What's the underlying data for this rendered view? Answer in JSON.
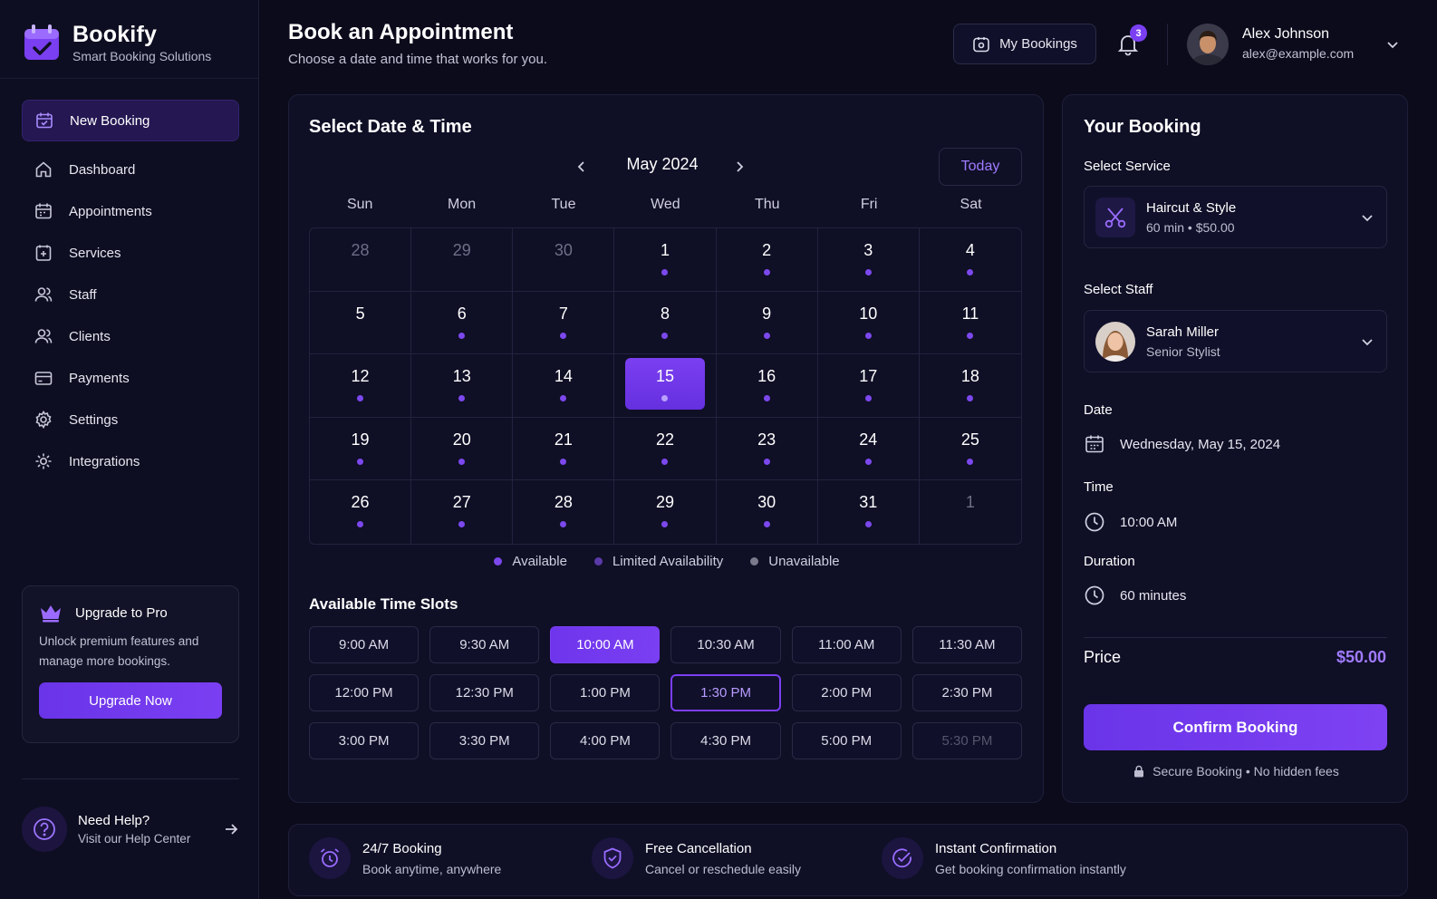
{
  "brand": {
    "name": "Bookify",
    "tagline": "Smart Booking Solutions"
  },
  "sidebar": {
    "items": [
      {
        "label": "New Booking",
        "icon": "calendar-icon",
        "active": true
      },
      {
        "label": "Dashboard",
        "icon": "home-icon"
      },
      {
        "label": "Appointments",
        "icon": "calendar-icon"
      },
      {
        "label": "Services",
        "icon": "services-icon"
      },
      {
        "label": "Staff",
        "icon": "users-icon"
      },
      {
        "label": "Clients",
        "icon": "users-icon"
      },
      {
        "label": "Payments",
        "icon": "credit-card-icon"
      },
      {
        "label": "Settings",
        "icon": "gear-icon"
      },
      {
        "label": "Integrations",
        "icon": "integrations-icon"
      }
    ],
    "upgrade": {
      "title": "Upgrade to Pro",
      "text": "Unlock premium features and manage more bookings.",
      "button": "Upgrade Now"
    },
    "help": {
      "title": "Need Help?",
      "subtitle": "Visit our Help Center"
    }
  },
  "header": {
    "title": "Book an Appointment",
    "subtitle": "Choose a date and time that works for you.",
    "my_bookings": "My Bookings",
    "notification_count": "3",
    "user": {
      "name": "Alex Johnson",
      "email": "alex@example.com"
    }
  },
  "calendar": {
    "title": "Select Date & Time",
    "month": "May 2024",
    "today_label": "Today",
    "weekdays": [
      "Sun",
      "Mon",
      "Tue",
      "Wed",
      "Thu",
      "Fri",
      "Sat"
    ],
    "days": [
      {
        "d": "28",
        "muted": true
      },
      {
        "d": "29",
        "muted": true
      },
      {
        "d": "30",
        "muted": true
      },
      {
        "d": "1",
        "dot": true
      },
      {
        "d": "2",
        "dot": true
      },
      {
        "d": "3",
        "dot": true
      },
      {
        "d": "4",
        "dot": true
      },
      {
        "d": "5"
      },
      {
        "d": "6",
        "dot": true
      },
      {
        "d": "7",
        "dot": true
      },
      {
        "d": "8",
        "dot": true
      },
      {
        "d": "9",
        "dot": true
      },
      {
        "d": "10",
        "dot": true
      },
      {
        "d": "11",
        "dot": true
      },
      {
        "d": "12",
        "dot": true
      },
      {
        "d": "13",
        "dot": true
      },
      {
        "d": "14",
        "dot": true
      },
      {
        "d": "15",
        "dot": true,
        "selected": true
      },
      {
        "d": "16",
        "dot": true
      },
      {
        "d": "17",
        "dot": true
      },
      {
        "d": "18",
        "dot": true
      },
      {
        "d": "19",
        "dot": true
      },
      {
        "d": "20",
        "dot": true
      },
      {
        "d": "21",
        "dot": true
      },
      {
        "d": "22",
        "dot": true
      },
      {
        "d": "23",
        "dot": true
      },
      {
        "d": "24",
        "dot": true
      },
      {
        "d": "25",
        "dot": true
      },
      {
        "d": "26",
        "dot": true
      },
      {
        "d": "27",
        "dot": true
      },
      {
        "d": "28",
        "dot": true
      },
      {
        "d": "29",
        "dot": true
      },
      {
        "d": "30",
        "dot": true
      },
      {
        "d": "31",
        "dot": true
      },
      {
        "d": "1",
        "muted": true
      }
    ],
    "legend": [
      {
        "label": "Available",
        "color": "#7c48ee"
      },
      {
        "label": "Limited Availability",
        "color": "#5a3aa8"
      },
      {
        "label": "Unavailable",
        "color": "#7a7a8c"
      }
    ],
    "slots_title": "Available Time Slots",
    "slots": [
      {
        "t": "9:00 AM"
      },
      {
        "t": "9:30 AM"
      },
      {
        "t": "10:00 AM",
        "state": "sel"
      },
      {
        "t": "10:30 AM"
      },
      {
        "t": "11:00 AM"
      },
      {
        "t": "11:30 AM"
      },
      {
        "t": "12:00 PM"
      },
      {
        "t": "12:30 PM"
      },
      {
        "t": "1:00 PM"
      },
      {
        "t": "1:30 PM",
        "state": "outline"
      },
      {
        "t": "2:00 PM"
      },
      {
        "t": "2:30 PM"
      },
      {
        "t": "3:00 PM"
      },
      {
        "t": "3:30 PM"
      },
      {
        "t": "4:00 PM"
      },
      {
        "t": "4:30 PM"
      },
      {
        "t": "5:00 PM"
      },
      {
        "t": "5:30 PM",
        "state": "disabled"
      }
    ]
  },
  "booking": {
    "title": "Your Booking",
    "service_label": "Select Service",
    "service": {
      "name": "Haircut & Style",
      "details": "60 min  •  $50.00"
    },
    "staff_label": "Select Staff",
    "staff": {
      "name": "Sarah Miller",
      "role": "Senior Stylist"
    },
    "date_label": "Date",
    "date": "Wednesday, May 15, 2024",
    "time_label": "Time",
    "time": "10:00 AM",
    "duration_label": "Duration",
    "duration": "60 minutes",
    "price_label": "Price",
    "price": "$50.00",
    "confirm": "Confirm Booking",
    "secure": "Secure Booking  •  No hidden fees"
  },
  "features": [
    {
      "title": "24/7 Booking",
      "subtitle": "Book anytime, anywhere",
      "icon": "alarm-clock-icon"
    },
    {
      "title": "Free Cancellation",
      "subtitle": "Cancel or reschedule easily",
      "icon": "shield-icon"
    },
    {
      "title": "Instant Confirmation",
      "subtitle": "Get booking confirmation instantly",
      "icon": "check-badge-icon"
    }
  ],
  "colors": {
    "accent": "#7b3ff2",
    "background": "#0b0b1c",
    "panel": "#0f0f26"
  }
}
